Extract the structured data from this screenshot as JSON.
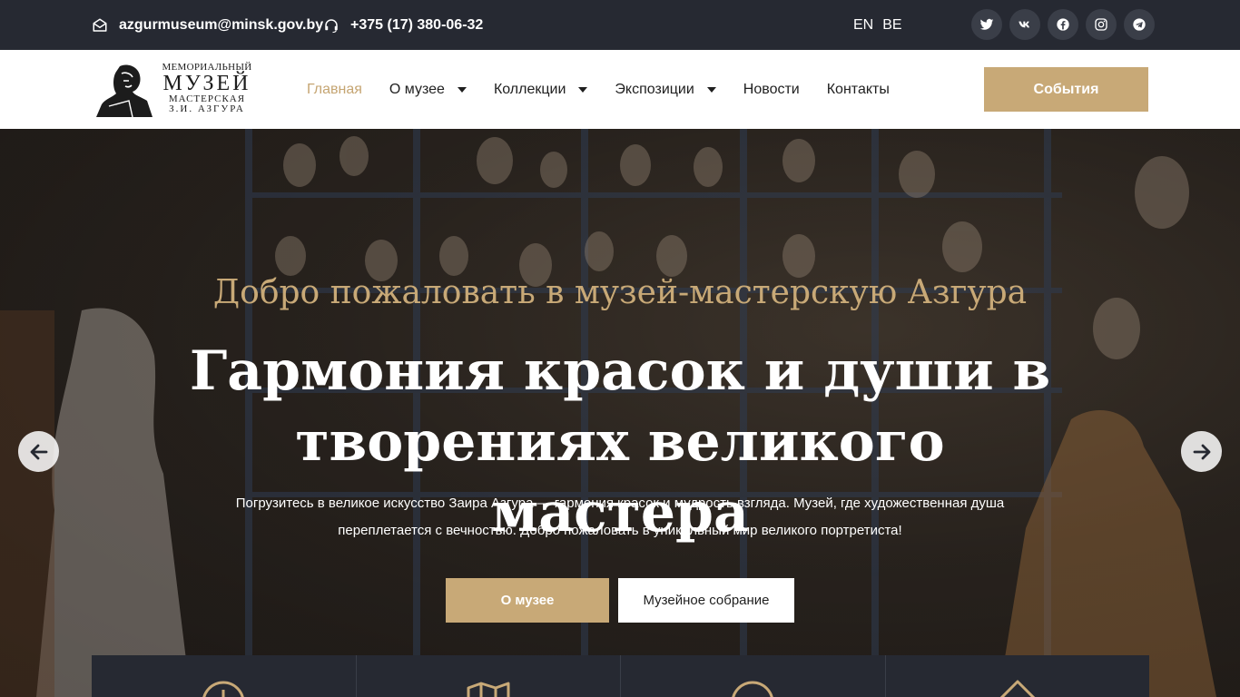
{
  "topbar": {
    "email": "azgurmuseum@minsk.gov.by",
    "phone": "+375 (17) 380-06-32",
    "langs": [
      "EN",
      "BE"
    ],
    "socials": [
      "twitter-icon",
      "vk-icon",
      "facebook-icon",
      "instagram-icon",
      "telegram-icon"
    ]
  },
  "logo": {
    "line1": "МЕМОРИАЛЬНЫЙ",
    "line2": "МУЗЕЙ",
    "line3": "МАСТЕРСКАЯ",
    "line4": "З.И. АЗГУРА"
  },
  "nav": {
    "items": [
      {
        "label": "Главная",
        "active": true
      },
      {
        "label": "О музее",
        "dropdown": true
      },
      {
        "label": "Коллекции",
        "dropdown": true
      },
      {
        "label": "Экспозиции",
        "dropdown": true
      },
      {
        "label": "Новости"
      },
      {
        "label": "Контакты"
      }
    ],
    "events_button": "События"
  },
  "hero": {
    "subtitle": "Добро пожаловать в музей-мастерскую Азгура",
    "title_line1": "Гармония красок и души в",
    "title_line2": "творениях великого мастера",
    "text_line1": "Погрузитесь в великое искусство Заира Азгура — гармония красок и мудрость взгляда. Музей, где художественная душа",
    "text_line2": "переплетается с вечностью. Добро пожаловать в уникальный мир великого портретиста!",
    "button_primary": "О музее",
    "button_secondary": "Музейное собрание"
  },
  "colors": {
    "accent": "#c8a977",
    "dark": "#262932",
    "white": "#ffffff"
  }
}
